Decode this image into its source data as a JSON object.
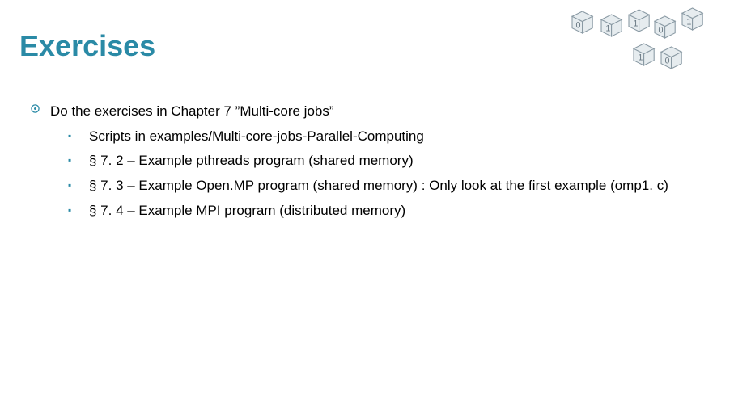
{
  "title": "Exercises",
  "main": {
    "text": "Do the exercises in Chapter 7 ”Multi-core jobs”",
    "subs": [
      "Scripts in examples/Multi-core-jobs-Parallel-Computing",
      "§ 7. 2 – Example pthreads program (shared memory)",
      "§ 7. 3 – Example Open.MP program (shared memory) : Only look at the first example (omp1. c)",
      "§ 7. 4 – Example MPI program (distributed memory)"
    ]
  }
}
